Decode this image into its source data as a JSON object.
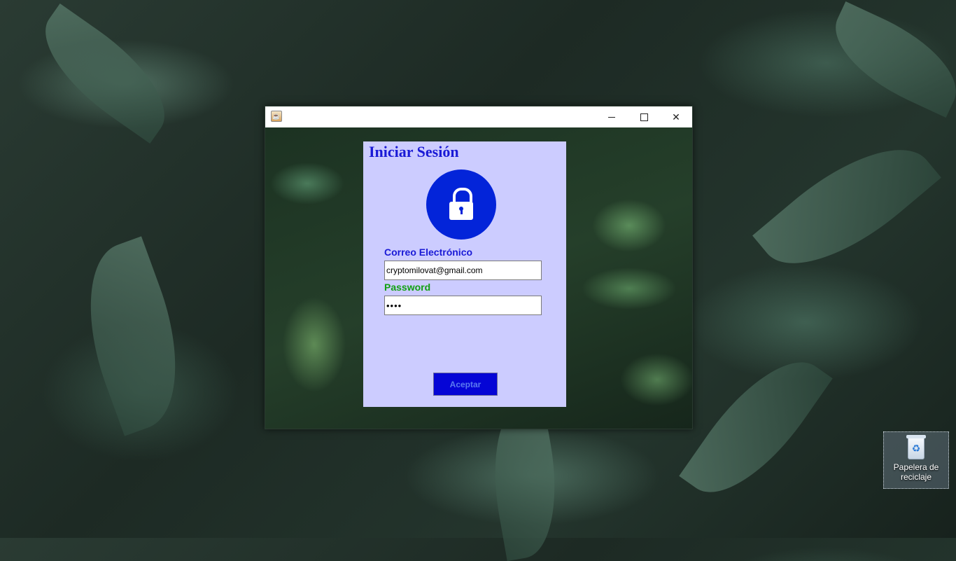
{
  "window": {
    "title": "",
    "app_icon": "java-cup-icon",
    "controls": {
      "minimize": "minimize-icon",
      "maximize": "maximize-icon",
      "close_glyph": "✕"
    }
  },
  "login": {
    "title": "Iniciar Sesión",
    "lock_icon": "lock-icon",
    "email_label": "Correo Electrónico",
    "email_value": "cryptomilovat@gmail.com",
    "password_label": "Password",
    "password_value": "••••",
    "submit_label": "Aceptar"
  },
  "desktop": {
    "recycle_bin": {
      "label": "Papelera de reciclaje",
      "icon": "recycle-bin-icon"
    }
  },
  "colors": {
    "panel": "#ccccff",
    "title_text": "#1a1ad6",
    "password_label": "#12a012",
    "lock_circle": "#0324d9",
    "button": "#0505d6"
  }
}
